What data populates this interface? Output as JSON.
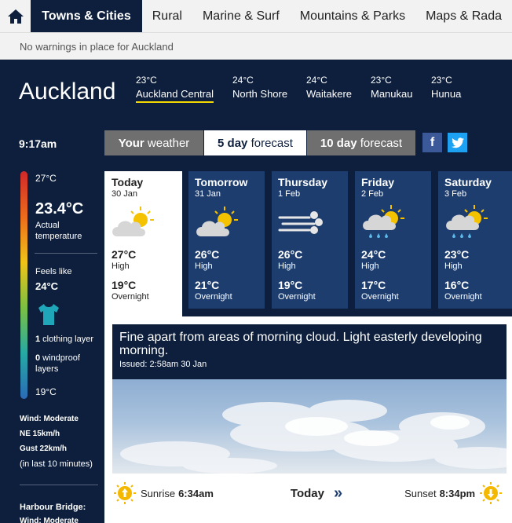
{
  "nav": {
    "items": [
      "Towns & Cities",
      "Rural",
      "Marine & Surf",
      "Mountains & Parks",
      "Maps & Rada"
    ]
  },
  "warning": "No warnings in place for Auckland",
  "city": "Auckland",
  "locations": [
    {
      "temp": "23°C",
      "name": "Auckland Central"
    },
    {
      "temp": "24°C",
      "name": "North Shore"
    },
    {
      "temp": "24°C",
      "name": "Waitakere"
    },
    {
      "temp": "23°C",
      "name": "Manukau"
    },
    {
      "temp": "23°C",
      "name": "Hunua"
    }
  ],
  "time": "9:17am",
  "tabs": [
    {
      "bold": "Your",
      "rest": " weather"
    },
    {
      "bold": "5 day",
      "rest": " forecast"
    },
    {
      "bold": "10 day",
      "rest": " forecast"
    }
  ],
  "social": {
    "facebook": "f",
    "twitter": "t"
  },
  "current": {
    "scale_top": "27°C",
    "temp": "23.4°C",
    "temp_label_1": "Actual",
    "temp_label_2": "temperature",
    "feels_label": "Feels like",
    "feels": "24°C",
    "clothing_count": "1",
    "clothing_text": " clothing layer",
    "windproof_count": "0",
    "windproof_text_1": " windproof",
    "windproof_text_2": "layers",
    "scale_bottom": "19°C",
    "wind_1": "Wind: Moderate",
    "wind_2": "NE 15km/h",
    "wind_3": "Gust 22km/h",
    "wind_4": "(in last 10 minutes)",
    "harbour": "Harbour Bridge:",
    "harbour_wind": "Wind: Moderate"
  },
  "days": [
    {
      "name": "Today",
      "date": "30 Jan",
      "high": "27°C",
      "high_label": "High",
      "low": "19°C",
      "low_label": "Overnight",
      "icon": "partly-cloudy-icon"
    },
    {
      "name": "Tomorrow",
      "date": "31 Jan",
      "high": "26°C",
      "high_label": "High",
      "low": "21°C",
      "low_label": "Overnight",
      "icon": "partly-cloudy-icon"
    },
    {
      "name": "Thursday",
      "date": "1 Feb",
      "high": "26°C",
      "high_label": "High",
      "low": "19°C",
      "low_label": "Overnight",
      "icon": "windy-icon"
    },
    {
      "name": "Friday",
      "date": "2 Feb",
      "high": "24°C",
      "high_label": "High",
      "low": "17°C",
      "low_label": "Overnight",
      "icon": "showers-icon"
    },
    {
      "name": "Saturday",
      "date": "3 Feb",
      "high": "23°C",
      "high_label": "High",
      "low": "16°C",
      "low_label": "Overnight",
      "icon": "showers-icon"
    }
  ],
  "forecast": {
    "text": "Fine apart from areas of morning cloud. Light easterly developing morning.",
    "issued": "Issued: 2:58am 30 Jan"
  },
  "sun": {
    "sunrise_label": "Sunrise ",
    "sunrise": "6:34am",
    "day": "Today",
    "next": "»",
    "sunset_label": "Sunset ",
    "sunset": "8:34pm"
  },
  "colors": {
    "navy": "#0d1f3c",
    "card": "#1d3d6e",
    "accent": "#f5d800",
    "facebook": "#3b5998",
    "twitter": "#1da1f2"
  }
}
